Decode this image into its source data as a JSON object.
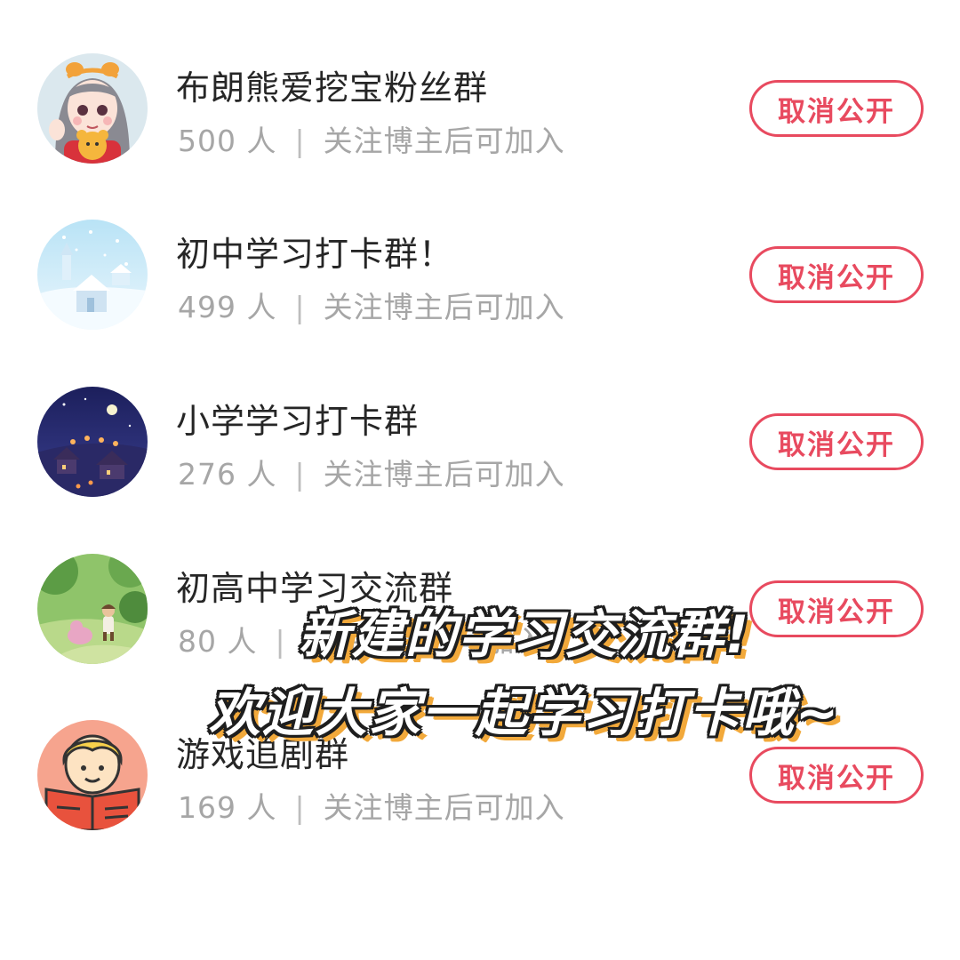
{
  "groups": [
    {
      "name": "布朗熊爱挖宝粉丝群",
      "members": "500 人",
      "separator": "|",
      "join_rule": "关注博主后可加入",
      "button": "取消公开",
      "avatar_icon": "girl-with-bear-avatar-icon"
    },
    {
      "name": "初中学习打卡群！",
      "members": "499 人",
      "separator": "|",
      "join_rule": "关注博主后可加入",
      "button": "取消公开",
      "avatar_icon": "snowy-castle-avatar-icon"
    },
    {
      "name": "小学学习打卡群",
      "members": "276 人",
      "separator": "|",
      "join_rule": "关注博主后可加入",
      "button": "取消公开",
      "avatar_icon": "night-village-avatar-icon"
    },
    {
      "name": "初高中学习交流群",
      "members": "80 人",
      "separator": "|",
      "join_rule": "关注博主后可加入",
      "button": "取消公开",
      "avatar_icon": "forest-game-avatar-icon"
    },
    {
      "name": "游戏追剧群",
      "members": "169 人",
      "separator": "|",
      "join_rule": "关注博主后可加入",
      "button": "取消公开",
      "avatar_icon": "reading-boy-avatar-icon"
    }
  ],
  "overlay": {
    "line1": "新建的学习交流群!",
    "line2": "欢迎大家一起学习打卡哦~"
  },
  "colors": {
    "accent": "#e84a5f",
    "title": "#262626",
    "meta": "#a6a6a6",
    "caption_shadow": "#f2a93b"
  }
}
